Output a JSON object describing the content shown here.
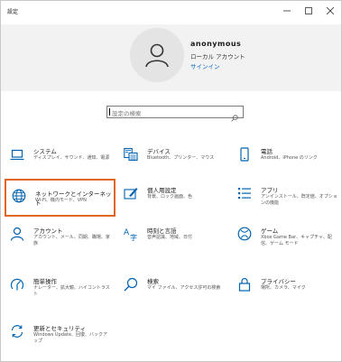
{
  "window": {
    "title": "設定",
    "controls": {
      "minimize": "–",
      "maximize": "□",
      "close": "✕"
    }
  },
  "account": {
    "name": "anonymous",
    "type": "ローカル アカウント",
    "signin": "サインイン"
  },
  "search": {
    "placeholder": "設定の検索"
  },
  "accent_colors": {
    "icon_blue": "#0063b1",
    "selection_outline": "#e0651f",
    "link": "#0067c0"
  },
  "tiles": [
    {
      "icon": "laptop-icon",
      "title": "システム",
      "desc": "ディスプレイ、サウンド、通知、電源"
    },
    {
      "icon": "keyboard-icon",
      "title": "デバイス",
      "desc": "Bluetooth、プリンター、マウス"
    },
    {
      "icon": "phone-icon",
      "title": "電話",
      "desc": "Android、iPhone のリンク"
    },
    {
      "icon": "globe-icon",
      "title": "ネットワークとインターネット",
      "desc": "Wi-Fi、機内モード、VPN",
      "selected": true
    },
    {
      "icon": "paintbrush-icon",
      "title": "個人用設定",
      "desc": "背景、ロック画面、色"
    },
    {
      "icon": "apps-list-icon",
      "title": "アプリ",
      "desc": "アンインストール、既定値、オプションの機能"
    },
    {
      "icon": "person-icon",
      "title": "アカウント",
      "desc": "アカウント、メール、同期、職場、家族"
    },
    {
      "icon": "language-icon",
      "title": "時刻と言語",
      "desc": "音声認識、地域、日付"
    },
    {
      "icon": "xbox-icon",
      "title": "ゲーム",
      "desc": "Xbox Game Bar、キャプチャ、配信、ゲーム モード"
    },
    {
      "icon": "accessibility-icon",
      "title": "簡単操作",
      "desc": "ナレーター、拡大鏡、ハイコントラスト"
    },
    {
      "icon": "search-icon",
      "title": "検索",
      "desc": "マイ ファイル、アクセス許可の検索"
    },
    {
      "icon": "lock-icon",
      "title": "プライバシー",
      "desc": "場所、カメラ、マイク"
    },
    {
      "icon": "sync-icon",
      "title": "更新とセキュリティ",
      "desc": "Windows Update、回復、バックアップ"
    }
  ]
}
